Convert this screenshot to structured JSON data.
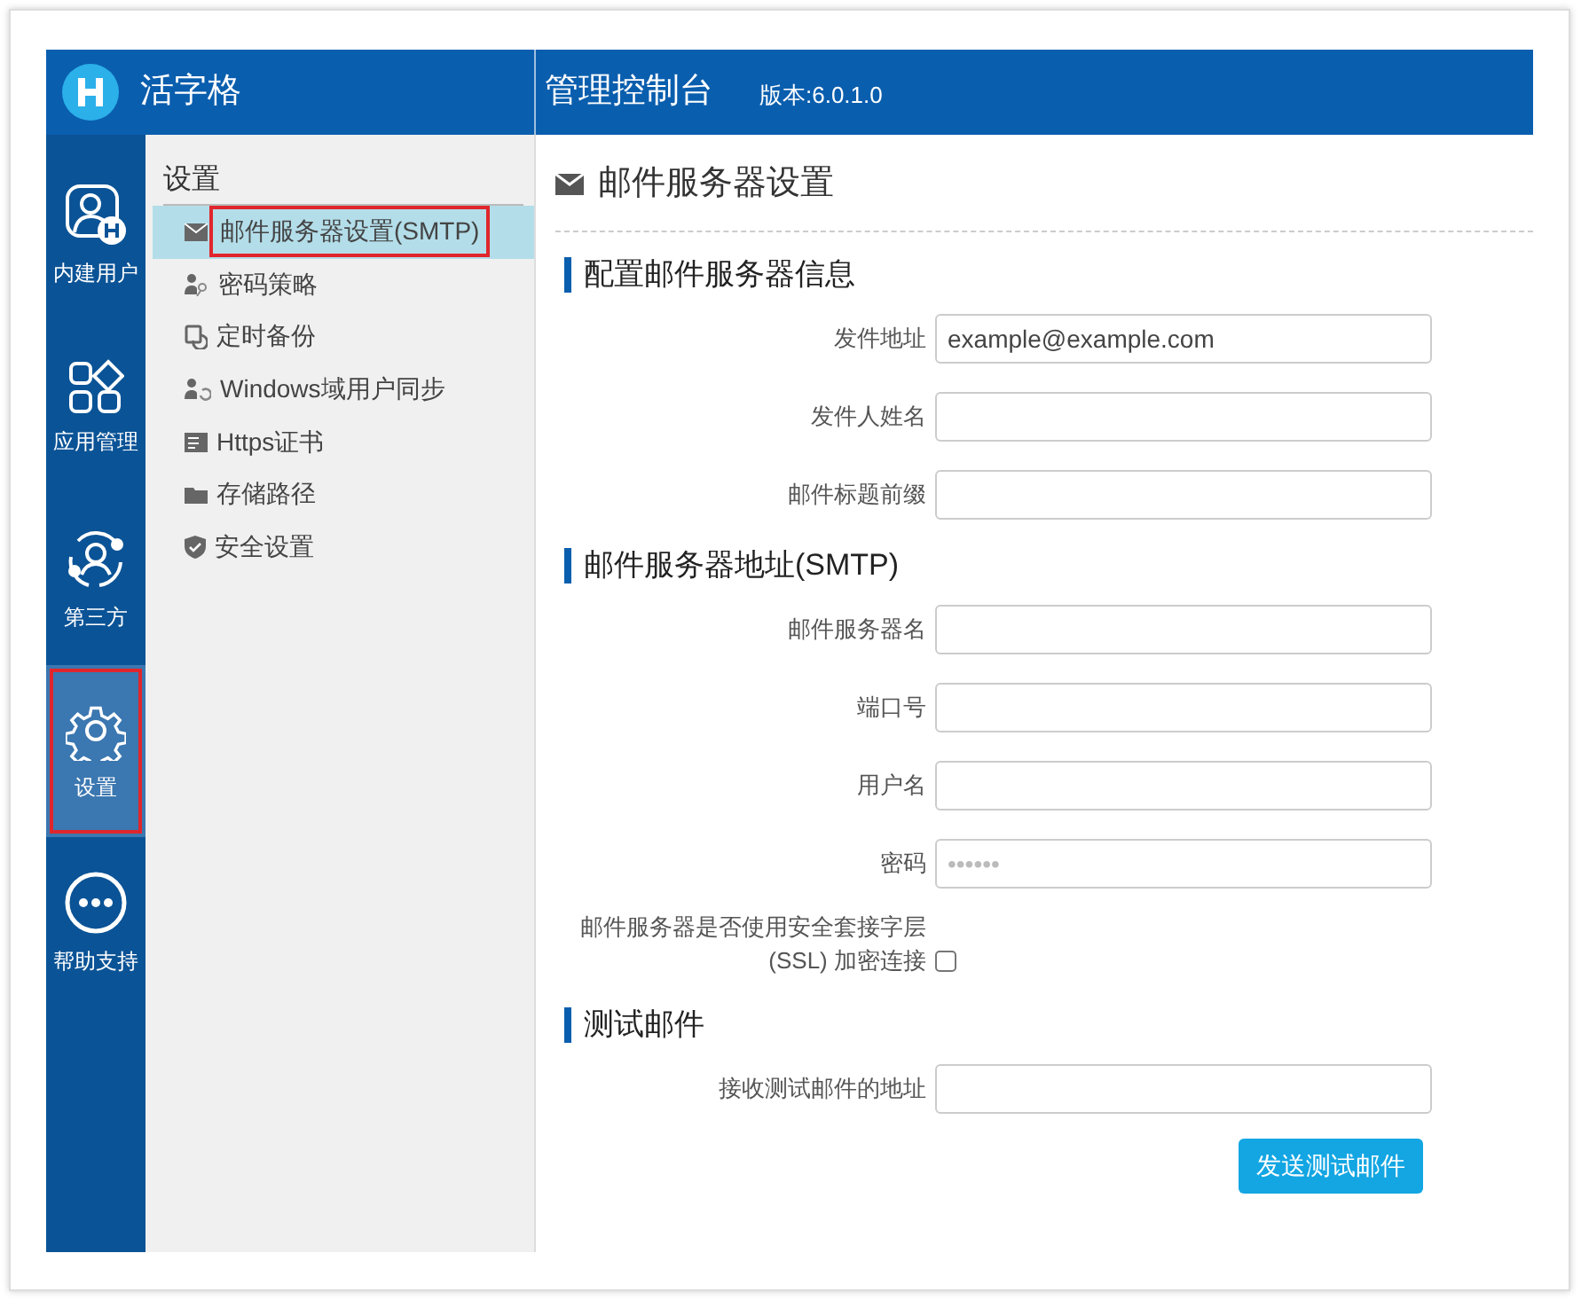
{
  "header": {
    "app_name": "活字格",
    "console_title": "管理控制台",
    "version": "版本:6.0.1.0"
  },
  "rail": [
    {
      "label": "内建用户",
      "selected": false,
      "annotated": false
    },
    {
      "label": "应用管理",
      "selected": false,
      "annotated": false
    },
    {
      "label": "第三方",
      "selected": false,
      "annotated": false
    },
    {
      "label": "设置",
      "selected": true,
      "annotated": true
    },
    {
      "label": "帮助支持",
      "selected": false,
      "annotated": false
    }
  ],
  "sidebar": {
    "title": "设置",
    "items": [
      {
        "label": "邮件服务器设置(SMTP)",
        "selected": true,
        "annotated": true
      },
      {
        "label": "密码策略",
        "selected": false,
        "annotated": false
      },
      {
        "label": "定时备份",
        "selected": false,
        "annotated": false
      },
      {
        "label": "Windows域用户同步",
        "selected": false,
        "annotated": false
      },
      {
        "label": "Https证书",
        "selected": false,
        "annotated": false
      },
      {
        "label": "存储路径",
        "selected": false,
        "annotated": false
      },
      {
        "label": "安全设置",
        "selected": false,
        "annotated": false
      }
    ]
  },
  "page": {
    "title": "邮件服务器设置"
  },
  "sections": [
    {
      "heading": "配置邮件服务器信息",
      "fields": [
        {
          "kind": "text",
          "label": "发件地址",
          "value": "example@example.com"
        },
        {
          "kind": "text",
          "label": "发件人姓名"
        },
        {
          "kind": "text",
          "label": "邮件标题前缀"
        }
      ]
    },
    {
      "heading": "邮件服务器地址(SMTP)",
      "fields": [
        {
          "kind": "text",
          "label": "邮件服务器名"
        },
        {
          "kind": "text",
          "label": "端口号"
        },
        {
          "kind": "text",
          "label": "用户名"
        },
        {
          "kind": "text",
          "label": "密码",
          "placeholder": "••••••"
        },
        {
          "kind": "checkbox",
          "label": "邮件服务器是否使用安全套接字层 (SSL) 加密连接",
          "checked": false
        }
      ]
    },
    {
      "heading": "测试邮件",
      "fields": [
        {
          "kind": "text",
          "label": "接收测试邮件的地址"
        }
      ]
    }
  ],
  "send_button": "发送测试邮件"
}
